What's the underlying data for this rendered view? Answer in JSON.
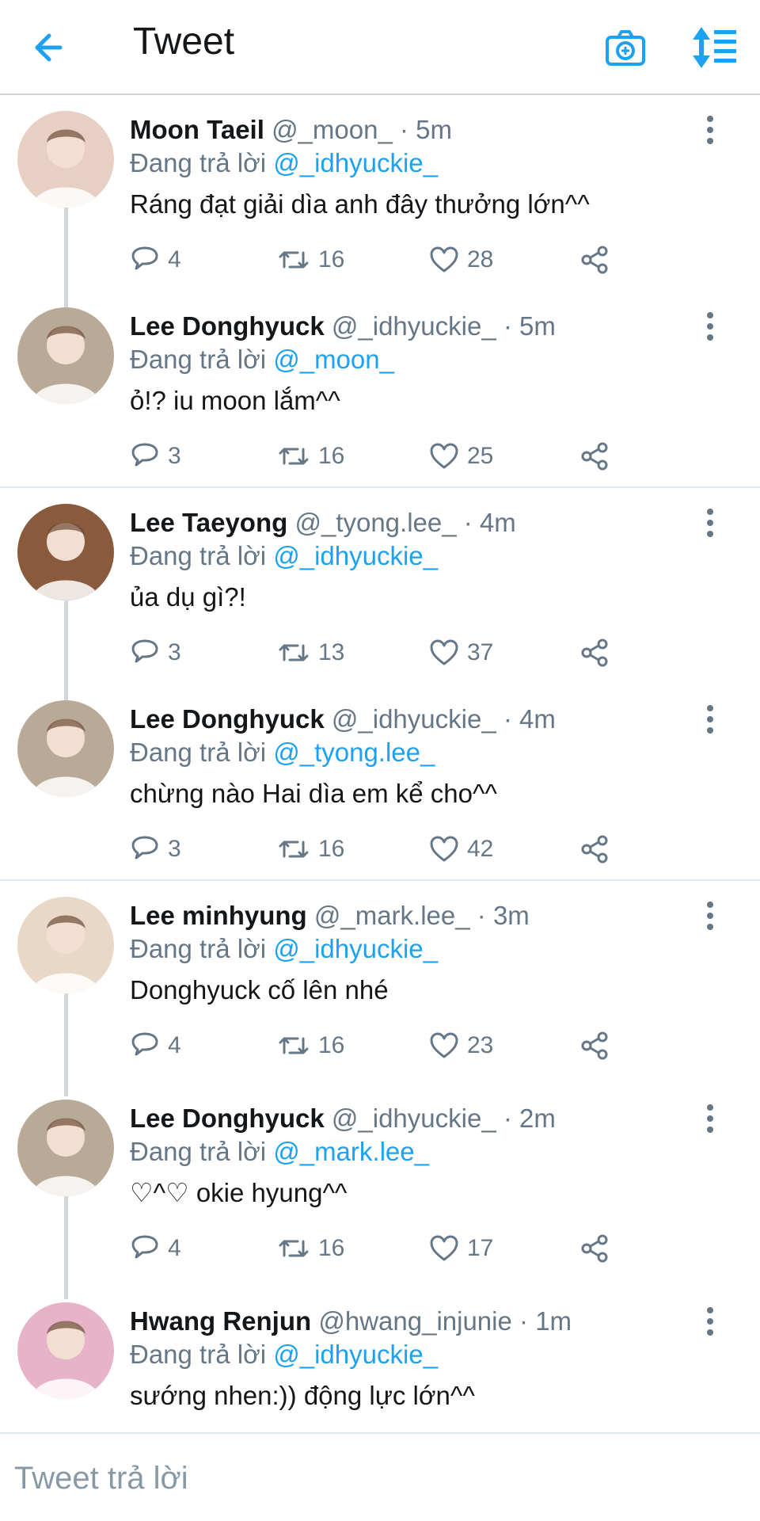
{
  "header": {
    "title": "Tweet",
    "back_icon": "arrow-left-icon",
    "camera_icon": "camera-icon",
    "sort_icon": "sort-icon",
    "accent": "#1da1f2"
  },
  "tweets": [
    {
      "name": "Moon Taeil",
      "handle": "@_moon_",
      "time": "5m",
      "reply_prefix": "Đang trả lời",
      "reply_to": "@_idhyuckie_",
      "text": "Ráng đạt giải dìa anh đây thưởng lớn^^",
      "replies": "4",
      "retweets": "16",
      "likes": "28",
      "avatar_color": "#e8cfc3"
    },
    {
      "name": "Lee Donghyuck",
      "handle": "@_idhyuckie_",
      "time": "5m",
      "reply_prefix": "Đang trả lời",
      "reply_to": "@_moon_",
      "text": "ỏ!? iu moon lắm^^",
      "replies": "3",
      "retweets": "16",
      "likes": "25",
      "avatar_color": "#b9aa97"
    },
    {
      "name": "Lee Taeyong",
      "handle": "@_tyong.lee_",
      "time": "4m",
      "reply_prefix": "Đang trả lời",
      "reply_to": "@_idhyuckie_",
      "text": "ủa dụ gì?!",
      "replies": "3",
      "retweets": "13",
      "likes": "37",
      "avatar_color": "#8a5a3c"
    },
    {
      "name": "Lee Donghyuck",
      "handle": "@_idhyuckie_",
      "time": "4m",
      "reply_prefix": "Đang trả lời",
      "reply_to": "@_tyong.lee_",
      "text": "chừng nào Hai dìa em kể cho^^",
      "replies": "3",
      "retweets": "16",
      "likes": "42",
      "avatar_color": "#b9aa97"
    },
    {
      "name": "Lee minhyung",
      "handle": "@_mark.lee_",
      "time": "3m",
      "reply_prefix": "Đang trả lời",
      "reply_to": "@_idhyuckie_",
      "text": "Donghyuck cố lên nhé",
      "replies": "4",
      "retweets": "16",
      "likes": "23",
      "avatar_color": "#e9d8c8"
    },
    {
      "name": "Lee Donghyuck",
      "handle": "@_idhyuckie_",
      "time": "2m",
      "reply_prefix": "Đang trả lời",
      "reply_to": "@_mark.lee_",
      "text": "♡^♡ okie hyung^^",
      "replies": "4",
      "retweets": "16",
      "likes": "17",
      "avatar_color": "#b9aa97"
    },
    {
      "name": "Hwang Renjun",
      "handle": "@hwang_injunie",
      "time": "1m",
      "reply_prefix": "Đang trả lời",
      "reply_to": "@_idhyuckie_",
      "text": "sướng nhen:)) động lực lớn^^",
      "replies": "",
      "retweets": "",
      "likes": "",
      "avatar_color": "#e7b3c8"
    }
  ],
  "composer": {
    "placeholder": "Tweet trả lời"
  },
  "icons": {
    "reply": "reply-icon",
    "retweet": "retweet-icon",
    "like": "heart-icon",
    "share": "share-icon",
    "more": "more-vertical-icon"
  }
}
